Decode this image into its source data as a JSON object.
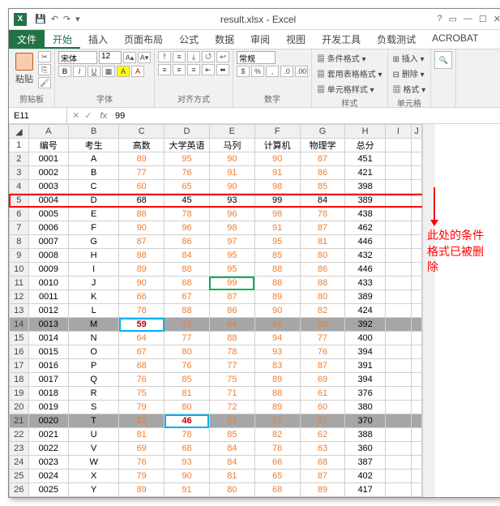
{
  "title": "result.xlsx - Excel",
  "tabs": {
    "file": "文件",
    "home": "开始",
    "insert": "插入",
    "layout": "页面布局",
    "formulas": "公式",
    "data": "数据",
    "review": "审阅",
    "view": "视图",
    "dev": "开发工具",
    "load": "负载测试",
    "acrobat": "ACROBAT"
  },
  "ribbon": {
    "paste": "粘贴",
    "clip": "剪贴板",
    "font": "字体",
    "fontname": "宋体",
    "fontsize": "12",
    "align": "对齐方式",
    "number": "数字",
    "numfmt": "常规",
    "styles": "样式",
    "cond": "条件格式",
    "tbl": "套用表格格式",
    "cell": "单元格样式",
    "cells": "单元格",
    "ins": "插入",
    "del": "删除",
    "fmt": "格式"
  },
  "namebox": "E11",
  "formula": "99",
  "cols": [
    "A",
    "B",
    "C",
    "D",
    "E",
    "F",
    "G",
    "H",
    "I",
    "J"
  ],
  "headers": [
    "编号",
    "考生",
    "高数",
    "大学英语",
    "马列",
    "计算机",
    "物理学",
    "总分"
  ],
  "data": [
    [
      "0001",
      "A",
      "89",
      "95",
      "90",
      "90",
      "87",
      "451"
    ],
    [
      "0002",
      "B",
      "77",
      "76",
      "91",
      "91",
      "86",
      "421"
    ],
    [
      "0003",
      "C",
      "60",
      "65",
      "90",
      "98",
      "85",
      "398"
    ],
    [
      "0004",
      "D",
      "68",
      "45",
      "93",
      "99",
      "84",
      "389"
    ],
    [
      "0005",
      "E",
      "88",
      "78",
      "96",
      "98",
      "78",
      "438"
    ],
    [
      "0006",
      "F",
      "90",
      "96",
      "98",
      "91",
      "87",
      "462"
    ],
    [
      "0007",
      "G",
      "87",
      "86",
      "97",
      "95",
      "81",
      "446"
    ],
    [
      "0008",
      "H",
      "88",
      "84",
      "95",
      "85",
      "80",
      "432"
    ],
    [
      "0009",
      "I",
      "89",
      "88",
      "95",
      "88",
      "86",
      "446"
    ],
    [
      "0010",
      "J",
      "90",
      "68",
      "99",
      "88",
      "88",
      "433"
    ],
    [
      "0011",
      "K",
      "66",
      "67",
      "87",
      "89",
      "80",
      "389"
    ],
    [
      "0012",
      "L",
      "78",
      "88",
      "86",
      "90",
      "82",
      "424"
    ],
    [
      "0013",
      "M",
      "59",
      "73",
      "84",
      "91",
      "88",
      "392"
    ],
    [
      "0014",
      "N",
      "64",
      "77",
      "88",
      "94",
      "77",
      "400"
    ],
    [
      "0015",
      "O",
      "67",
      "80",
      "78",
      "93",
      "76",
      "394"
    ],
    [
      "0016",
      "P",
      "68",
      "76",
      "77",
      "83",
      "87",
      "391"
    ],
    [
      "0017",
      "Q",
      "76",
      "85",
      "75",
      "89",
      "69",
      "394"
    ],
    [
      "0018",
      "R",
      "75",
      "81",
      "71",
      "88",
      "61",
      "376"
    ],
    [
      "0019",
      "S",
      "79",
      "80",
      "72",
      "89",
      "60",
      "380"
    ],
    [
      "0020",
      "T",
      "83",
      "46",
      "87",
      "87",
      "87",
      "370"
    ],
    [
      "0021",
      "U",
      "81",
      "78",
      "85",
      "82",
      "62",
      "388"
    ],
    [
      "0022",
      "V",
      "69",
      "68",
      "84",
      "76",
      "63",
      "360"
    ],
    [
      "0023",
      "W",
      "76",
      "93",
      "84",
      "66",
      "68",
      "387"
    ],
    [
      "0024",
      "X",
      "79",
      "90",
      "81",
      "65",
      "87",
      "402"
    ],
    [
      "0025",
      "Y",
      "89",
      "91",
      "80",
      "68",
      "89",
      "417"
    ]
  ],
  "annot": {
    "l1": "此处的条件",
    "l2": "格式已被删",
    "l3": "除"
  }
}
